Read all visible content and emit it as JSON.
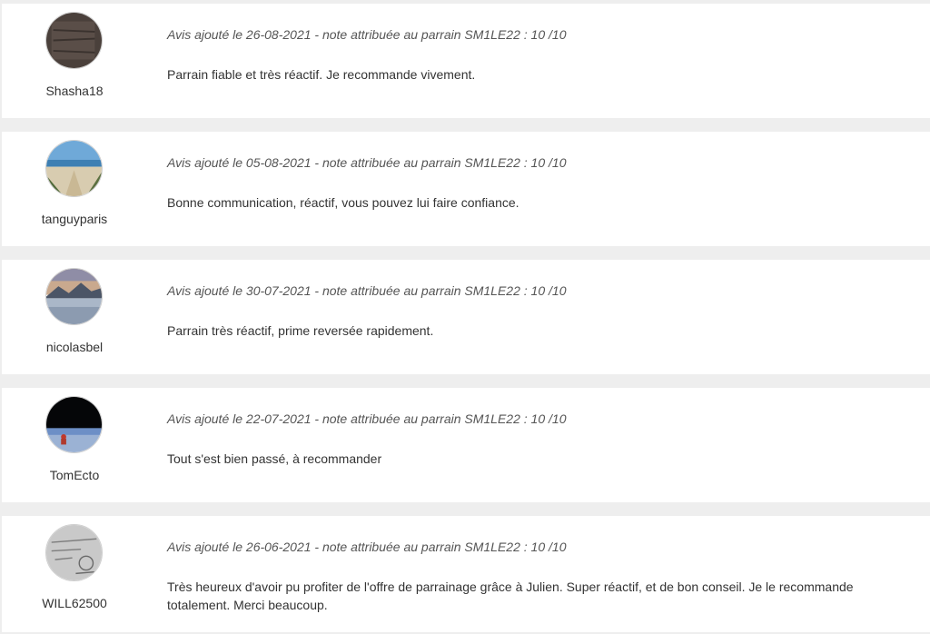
{
  "reviews": [
    {
      "username": "Shasha18",
      "meta": "Avis ajouté le 26-08-2021 - note attribuée au parrain SM1LE22 : 10 /10",
      "comment": "Parrain fiable et très réactif. Je recommande vivement.",
      "avatar_icon": "dark-texture-avatar"
    },
    {
      "username": "tanguyparis",
      "meta": "Avis ajouté le 05-08-2021 - note attribuée au parrain SM1LE22 : 10 /10",
      "comment": "Bonne communication, réactif, vous pouvez lui faire confiance.",
      "avatar_icon": "beach-avatar"
    },
    {
      "username": "nicolasbel",
      "meta": "Avis ajouté le 30-07-2021 - note attribuée au parrain SM1LE22 : 10 /10",
      "comment": "Parrain très réactif, prime reversée rapidement.",
      "avatar_icon": "mountain-lake-avatar"
    },
    {
      "username": "TomEcto",
      "meta": "Avis ajouté le 22-07-2021 - note attribuée au parrain SM1LE22 : 10 /10",
      "comment": "Tout s'est bien passé, à recommander",
      "avatar_icon": "night-sky-person-avatar"
    },
    {
      "username": "WILL62500",
      "meta": "Avis ajouté le 26-06-2021 - note attribuée au parrain SM1LE22 : 10 /10",
      "comment": "Très heureux d'avoir pu profiter de l'offre de parrainage grâce à Julien. Super réactif, et de bon conseil.  Je le recommande totalement. Merci beaucoup.",
      "avatar_icon": "sketch-avatar"
    }
  ]
}
